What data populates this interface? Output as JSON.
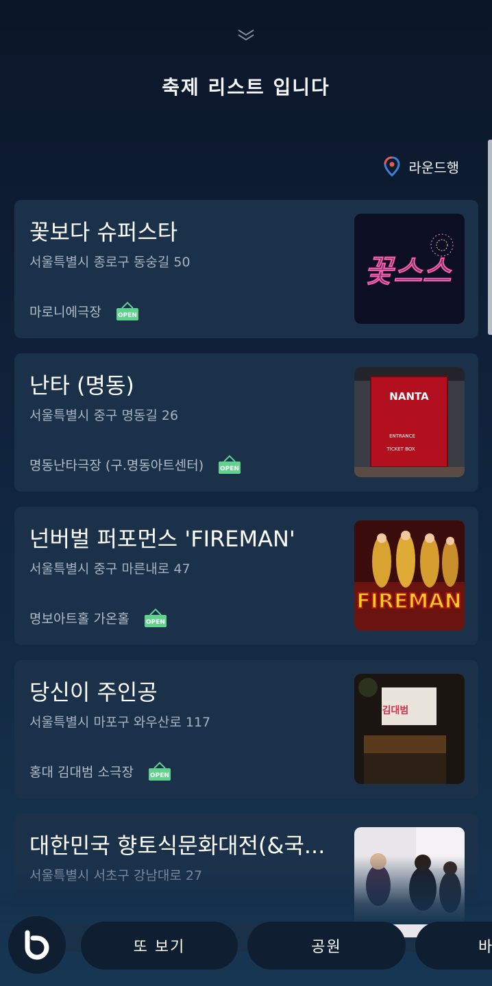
{
  "page": {
    "title": "축제 리스트 입니다"
  },
  "round_trip": {
    "label": "라운드행",
    "icon": "map-pin-icon"
  },
  "colors": {
    "card_bg": "#1b3149",
    "open_badge": "#5fd38d",
    "pin_red": "#e95b4f",
    "pin_blue": "#3b82d6"
  },
  "cards": [
    {
      "title": "꽃보다 슈퍼스타",
      "address": "서울특별시 종로구 동숭길 50",
      "venue": "마로니에극장",
      "status": "OPEN",
      "thumb_text": "꽃스스"
    },
    {
      "title": "난타 (명동)",
      "address": "서울특별시 중구 명동길 26",
      "venue": "명동난타극장 (구.명동아트센터)",
      "status": "OPEN",
      "thumb_text": "NANTA",
      "thumb_sub1": "ENTRANCE",
      "thumb_sub2": "TICKET BOX"
    },
    {
      "title": "넌버벌 퍼포먼스 'FIREMAN'",
      "address": "서울특별시 중구 마른내로 47",
      "venue": "명보아트홀 가온홀",
      "status": "OPEN",
      "thumb_text": "FIREMAN"
    },
    {
      "title": "당신이 주인공",
      "address": "서울특별시 마포구 와우산로 117",
      "venue": "홍대 김대범 소극장",
      "status": "OPEN",
      "thumb_text": "김대범"
    },
    {
      "title": "대한민국 향토식문화대전(&국...",
      "address": "서울특별시 서초구 강남대로 27",
      "venue": "",
      "status": ""
    }
  ],
  "bottom_bar": {
    "assistant_icon": "bixby-icon",
    "chips": [
      "또 보기",
      "공원",
      "바"
    ]
  }
}
